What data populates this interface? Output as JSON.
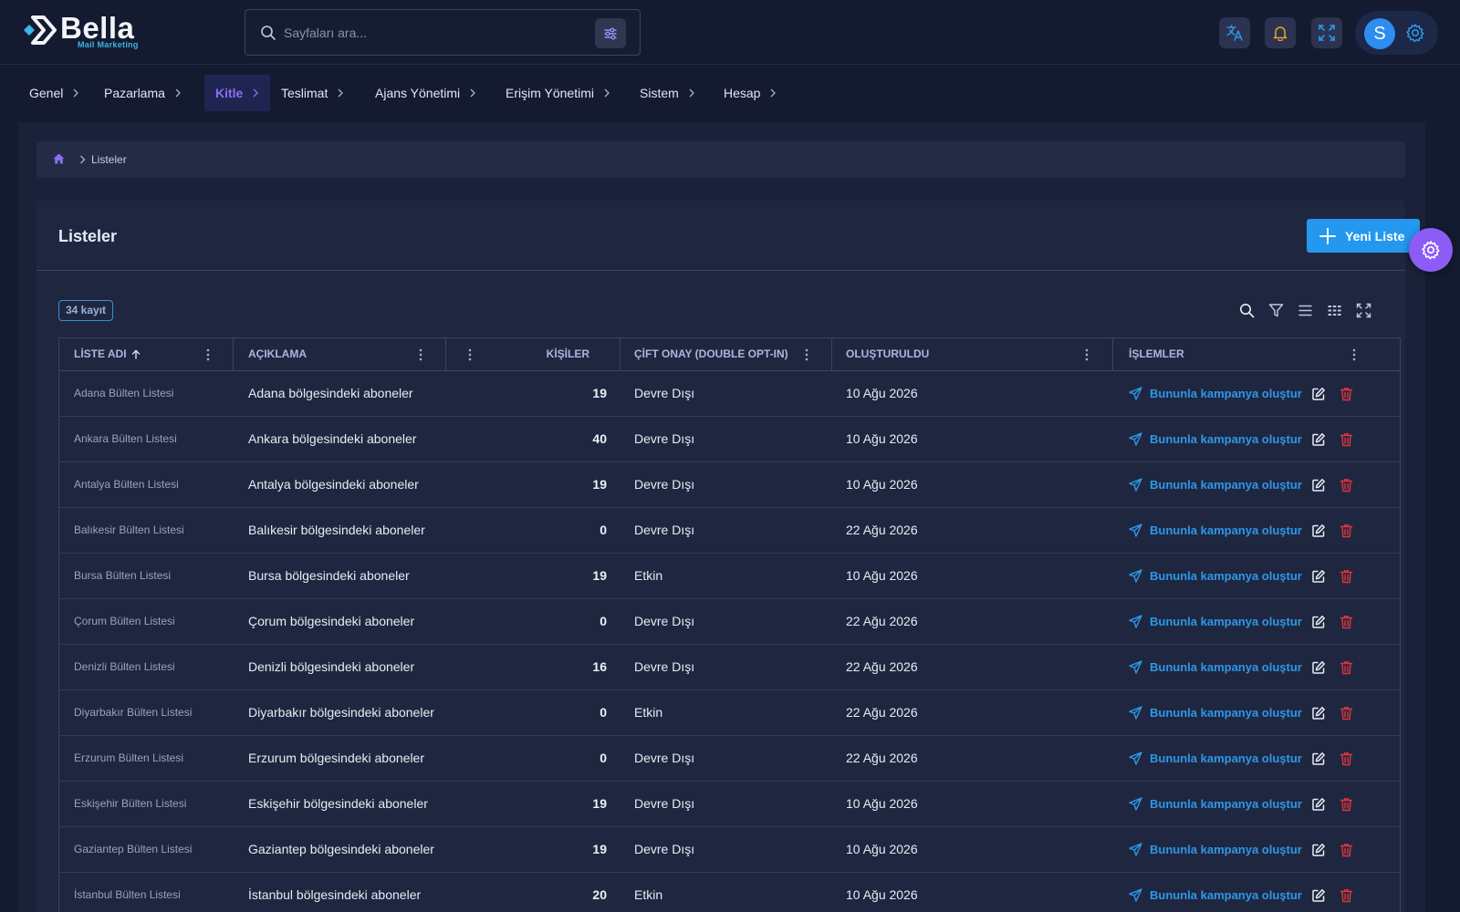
{
  "brand": {
    "name": "Bella",
    "tagline": "Mail Marketing"
  },
  "search": {
    "placeholder": "Sayfaları ara...",
    "value": ""
  },
  "header_icons": [
    "translate-icon",
    "bell-icon",
    "fullscreen-icon",
    "gear-icon"
  ],
  "user": {
    "initial": "S"
  },
  "menu": [
    {
      "label": "Genel",
      "active": false
    },
    {
      "label": "Pazarlama",
      "active": false
    },
    {
      "label": "Kitle",
      "active": true
    },
    {
      "label": "Teslimat",
      "active": false
    },
    {
      "label": "Ajans Yönetimi",
      "active": false
    },
    {
      "label": "Erişim Yönetimi",
      "active": false
    },
    {
      "label": "Sistem",
      "active": false
    },
    {
      "label": "Hesap",
      "active": false
    }
  ],
  "breadcrumb": {
    "current": "Listeler"
  },
  "page": {
    "title": "Listeler",
    "new_button": "Yeni Liste",
    "record_count": "34 kayıt"
  },
  "colors": {
    "accent": "#2398ee",
    "active_menu": "#8b6ef5",
    "delete": "#e0343f",
    "fab": "#8b5cf6"
  },
  "table": {
    "columns": {
      "name": "LİSTE ADI",
      "description": "AÇIKLAMA",
      "count": "KİŞİLER",
      "double_opt_in": "ÇİFT ONAY (DOUBLE OPT-IN)",
      "created": "OLUŞTURULDU",
      "actions": "İŞLEMLER"
    },
    "sort": {
      "column": "name",
      "direction": "ascending"
    },
    "action_label": "Bununla kampanya oluştur",
    "rows": [
      {
        "name": "Adana Bülten Listesi",
        "description": "Adana bölgesindeki aboneler",
        "count": "19",
        "double_opt_in": "Devre Dışı",
        "created": "10 Ağu 2026"
      },
      {
        "name": "Ankara Bülten Listesi",
        "description": "Ankara bölgesindeki aboneler",
        "count": "40",
        "double_opt_in": "Devre Dışı",
        "created": "10 Ağu 2026"
      },
      {
        "name": "Antalya Bülten Listesi",
        "description": "Antalya bölgesindeki aboneler",
        "count": "19",
        "double_opt_in": "Devre Dışı",
        "created": "10 Ağu 2026"
      },
      {
        "name": "Balıkesir Bülten Listesi",
        "description": "Balıkesir bölgesindeki aboneler",
        "count": "0",
        "double_opt_in": "Devre Dışı",
        "created": "22 Ağu 2026"
      },
      {
        "name": "Bursa Bülten Listesi",
        "description": "Bursa bölgesindeki aboneler",
        "count": "19",
        "double_opt_in": "Etkin",
        "created": "10 Ağu 2026"
      },
      {
        "name": "Çorum Bülten Listesi",
        "description": "Çorum bölgesindeki aboneler",
        "count": "0",
        "double_opt_in": "Devre Dışı",
        "created": "22 Ağu 2026"
      },
      {
        "name": "Denizli Bülten Listesi",
        "description": "Denizli bölgesindeki aboneler",
        "count": "16",
        "double_opt_in": "Devre Dışı",
        "created": "22 Ağu 2026"
      },
      {
        "name": "Diyarbakır Bülten Listesi",
        "description": "Diyarbakır bölgesindeki aboneler",
        "count": "0",
        "double_opt_in": "Etkin",
        "created": "22 Ağu 2026"
      },
      {
        "name": "Erzurum Bülten Listesi",
        "description": "Erzurum bölgesindeki aboneler",
        "count": "0",
        "double_opt_in": "Devre Dışı",
        "created": "22 Ağu 2026"
      },
      {
        "name": "Eskişehir Bülten Listesi",
        "description": "Eskişehir bölgesindeki aboneler",
        "count": "19",
        "double_opt_in": "Devre Dışı",
        "created": "10 Ağu 2026"
      },
      {
        "name": "Gaziantep Bülten Listesi",
        "description": "Gaziantep bölgesindeki aboneler",
        "count": "19",
        "double_opt_in": "Devre Dışı",
        "created": "10 Ağu 2026"
      },
      {
        "name": "İstanbul Bülten Listesi",
        "description": "İstanbul bölgesindeki aboneler",
        "count": "20",
        "double_opt_in": "Etkin",
        "created": "10 Ağu 2026"
      }
    ]
  }
}
